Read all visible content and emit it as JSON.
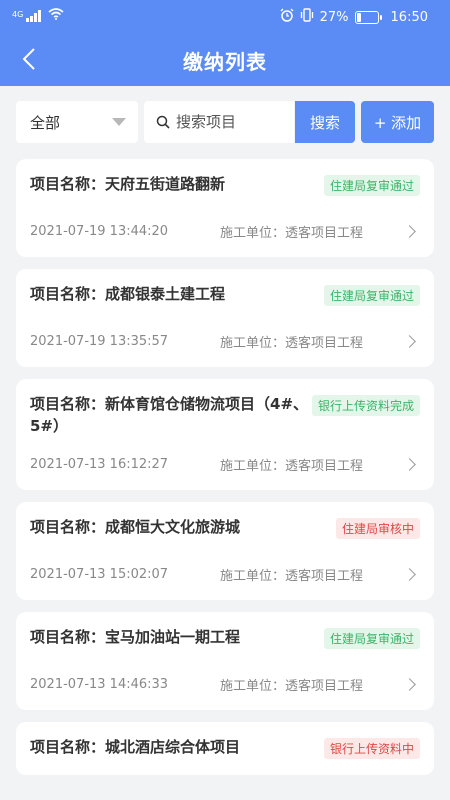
{
  "status_bar": {
    "signal_label": "4G",
    "battery": "27%",
    "battery_level": 0.27,
    "time": "16:50",
    "icons": [
      "signal-icon",
      "wifi-icon",
      "alarm-icon",
      "vibrate-icon",
      "battery-icon"
    ]
  },
  "header": {
    "title": "缴纳列表",
    "back_icon": "back-arrow-icon"
  },
  "toolbar": {
    "filter_value": "全部",
    "search_placeholder": "搜索项目",
    "search_label": "搜索",
    "add_label": "+ 添加"
  },
  "list": {
    "name_label": "项目名称：",
    "unit_label": "施工单位：",
    "items": [
      {
        "name": "天府五街道路翻新",
        "status": "住建局复审通过",
        "status_color": "green",
        "time": "2021-07-19 13:44:20",
        "unit": "透客项目工程"
      },
      {
        "name": "成都银泰土建工程",
        "status": "住建局复审通过",
        "status_color": "green",
        "time": "2021-07-19 13:35:57",
        "unit": "透客项目工程"
      },
      {
        "name": "新体育馆仓储物流项目（4#、5#）",
        "status": "银行上传资料完成",
        "status_color": "green",
        "time": "2021-07-13 16:12:27",
        "unit": "透客项目工程"
      },
      {
        "name": "成都恒大文化旅游城",
        "status": "住建局审核中",
        "status_color": "red",
        "time": "2021-07-13 15:02:07",
        "unit": "透客项目工程"
      },
      {
        "name": "宝马加油站一期工程",
        "status": "住建局复审通过",
        "status_color": "green",
        "time": "2021-07-13 14:46:33",
        "unit": "透客项目工程"
      },
      {
        "name": "城北酒店综合体项目",
        "status": "银行上传资料中",
        "status_color": "red",
        "time": "",
        "unit": ""
      }
    ]
  }
}
